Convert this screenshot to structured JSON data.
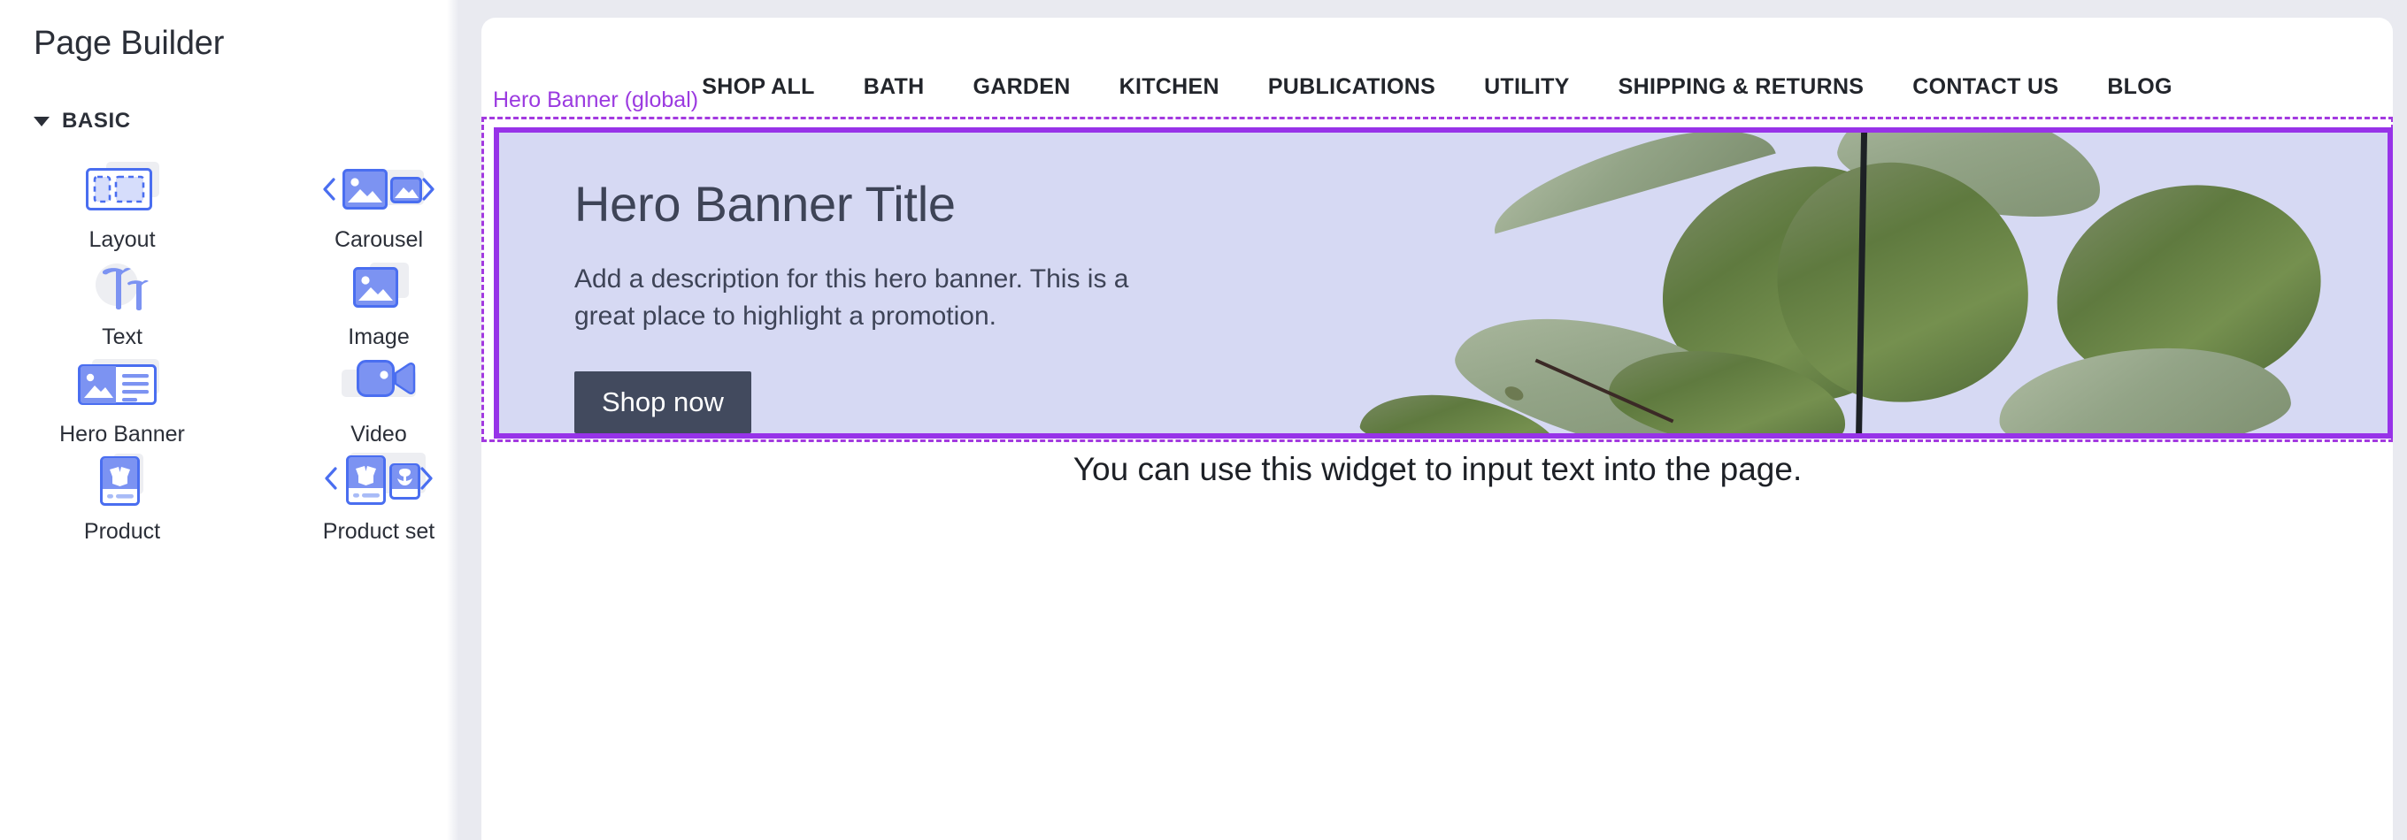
{
  "sidebar": {
    "title": "Page Builder",
    "section": {
      "label": "BASIC",
      "caret_icon": "chevron-down-icon",
      "expanded": true
    },
    "widgets": [
      {
        "label": "Layout",
        "icon": "layout-icon"
      },
      {
        "label": "Carousel",
        "icon": "carousel-icon"
      },
      {
        "label": "Text",
        "icon": "text-icon"
      },
      {
        "label": "Image",
        "icon": "image-icon"
      },
      {
        "label": "Hero Banner",
        "icon": "hero-banner-icon"
      },
      {
        "label": "Video",
        "icon": "video-icon"
      },
      {
        "label": "Product",
        "icon": "product-icon"
      },
      {
        "label": "Product set",
        "icon": "product-set-icon"
      }
    ]
  },
  "preview": {
    "store_nav": [
      "SHOP ALL",
      "BATH",
      "GARDEN",
      "KITCHEN",
      "PUBLICATIONS",
      "UTILITY",
      "SHIPPING & RETURNS",
      "CONTACT US",
      "BLOG"
    ],
    "selected_widget": {
      "tag_label": "Hero Banner (global)",
      "outline_color": "#9733e8",
      "tag_color": "#9b3ae0"
    },
    "hero": {
      "title": "Hero Banner Title",
      "description": "Add a description for this hero banner. This is a great place to highlight a promotion.",
      "cta_label": "Shop now",
      "background_color": "#d6d9f3",
      "cta_color": "#424a5e",
      "text_color": "#3e4457",
      "image_alt": "plant-leaves-photo"
    },
    "text_widget": {
      "content": "You can use this widget to input text into the page."
    }
  },
  "theme": {
    "accent_blue": "#5b7cf5",
    "icon_light_blue": "#d6ddfb",
    "icon_gray": "#edeef2",
    "panel_gray": "#e9eaf0",
    "text_dark": "#2b2f38"
  }
}
